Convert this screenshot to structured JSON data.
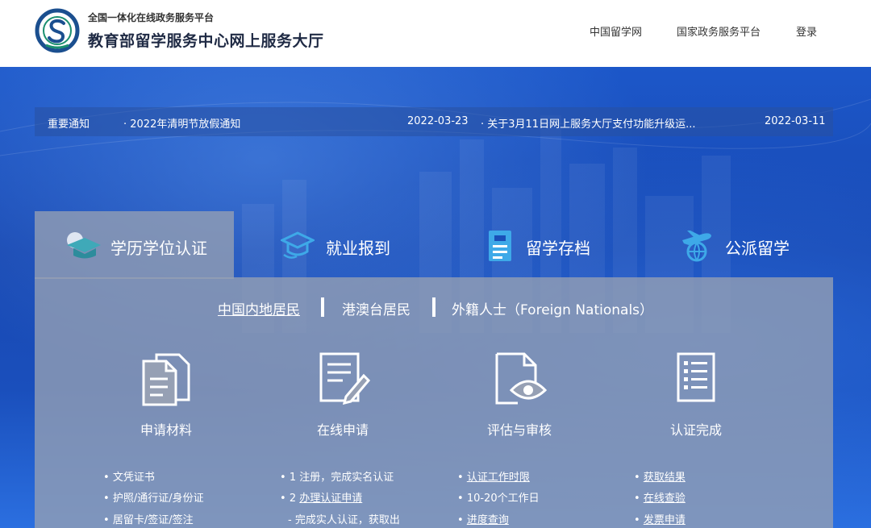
{
  "brand": {
    "subtitle": "全国一体化在线政务服务平台",
    "title": "教育部留学服务中心网上服务大厅"
  },
  "topnav": [
    "中国留学网",
    "国家政务服务平台",
    "登录"
  ],
  "notice": {
    "label": "重要通知",
    "items": [
      {
        "text": "· 2022年清明节放假通知",
        "date": "2022-03-23"
      },
      {
        "text": "· 关于3月11日网上服务大厅支付功能升级运...",
        "date": "2022-03-11"
      }
    ]
  },
  "tabs": [
    {
      "label": "学历学位认证",
      "icon": "graduation-cap-icon",
      "active": true
    },
    {
      "label": "就业报到",
      "icon": "hat-hands-icon",
      "active": false
    },
    {
      "label": "留学存档",
      "icon": "archive-icon",
      "active": false
    },
    {
      "label": "公派留学",
      "icon": "plane-globe-icon",
      "active": false
    }
  ],
  "subtabs": [
    "中国内地居民",
    "港澳台居民",
    "外籍人士（Foreign Nationals）"
  ],
  "steps": [
    {
      "label": "申请材料",
      "icon": "documents-icon",
      "items": [
        {
          "text": "文凭证书",
          "link": false
        },
        {
          "text": "护照/通行证/身份证",
          "link": false
        },
        {
          "text": "居留卡/签证/签注",
          "link": false
        }
      ]
    },
    {
      "label": "在线申请",
      "icon": "form-edit-icon",
      "items": [
        {
          "text": "1 注册，完成实名认证",
          "link": false
        },
        {
          "text": "2 办理认证申请",
          "link": true
        },
        {
          "text": "- 完成实人认证，获取出",
          "link": false
        }
      ]
    },
    {
      "label": "评估与审核",
      "icon": "eye-document-icon",
      "items": [
        {
          "text": "认证工作时限",
          "link": true
        },
        {
          "text": "10-20个工作日",
          "link": false
        },
        {
          "text": "进度查询",
          "link": true
        }
      ]
    },
    {
      "label": "认证完成",
      "icon": "checklist-icon",
      "items": [
        {
          "text": "获取结果",
          "link": true
        },
        {
          "text": "在线查验",
          "link": true
        },
        {
          "text": "发票申请",
          "link": true
        }
      ]
    }
  ],
  "colors": {
    "hero": "#1a4fb8",
    "panel": "#9aa3b6",
    "accent": "#1f9bd8"
  }
}
